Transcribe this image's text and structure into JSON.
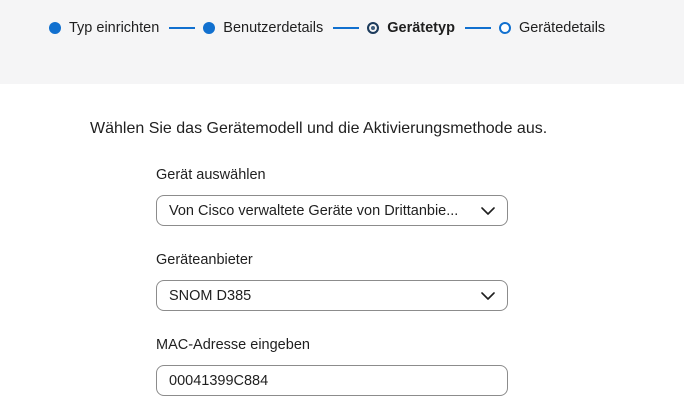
{
  "wizard": {
    "steps": [
      {
        "label": "Typ einrichten",
        "state": "done"
      },
      {
        "label": "Benutzerdetails",
        "state": "done"
      },
      {
        "label": "Gerätetyp",
        "state": "current"
      },
      {
        "label": "Gerätedetails",
        "state": "todo"
      }
    ],
    "accent_color": "#1170cf"
  },
  "form": {
    "instruction": "Wählen Sie das Gerätemodell und die Aktivierungsmethode aus.",
    "device_select": {
      "label": "Gerät auswählen",
      "value": "Von Cisco verwaltete Geräte von Drittanbie..."
    },
    "vendor_select": {
      "label": "Geräteanbieter",
      "value": "SNOM D385"
    },
    "mac_input": {
      "label": "MAC-Adresse eingeben",
      "value": "00041399C884"
    }
  }
}
